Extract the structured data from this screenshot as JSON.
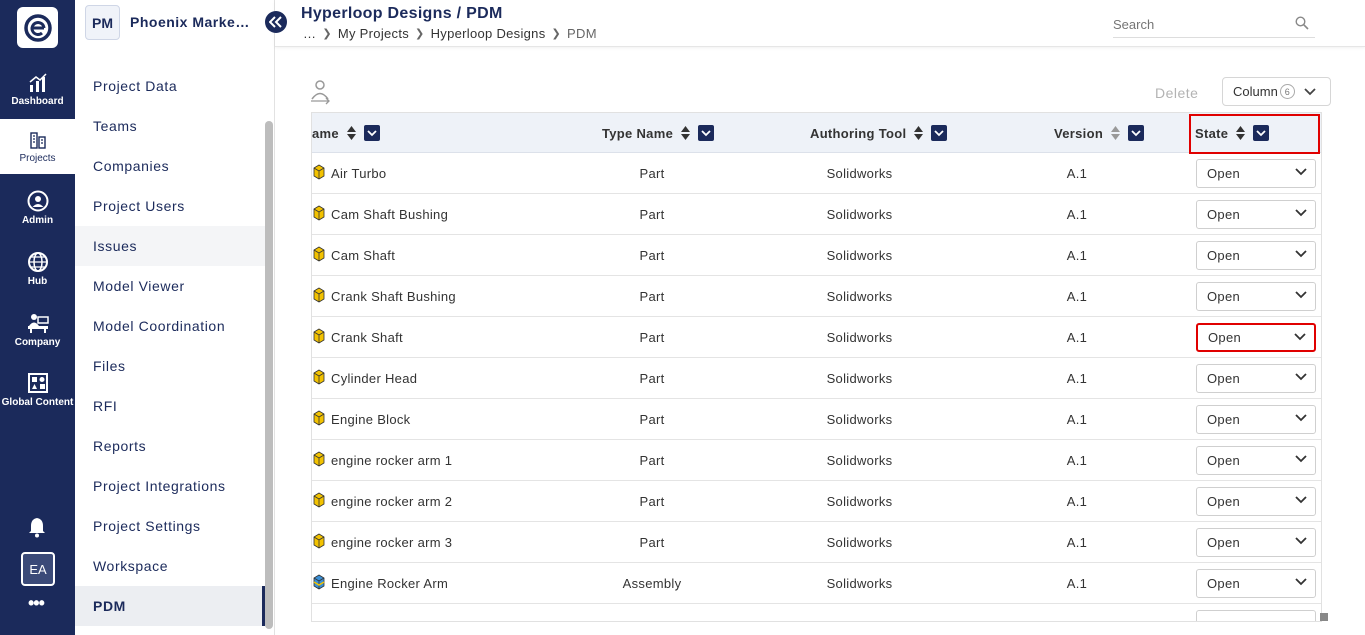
{
  "rail": {
    "items": [
      {
        "label": "Dashboard",
        "icon": "dashboard-icon"
      },
      {
        "label": "Projects",
        "icon": "projects-icon"
      },
      {
        "label": "Admin",
        "icon": "admin-icon"
      },
      {
        "label": "Hub",
        "icon": "hub-icon"
      },
      {
        "label": "Company",
        "icon": "company-icon"
      },
      {
        "label": "Global Content",
        "icon": "global-content-icon"
      }
    ],
    "active": "Projects",
    "avatar": "EA",
    "more": "•••"
  },
  "project": {
    "badge": "PM",
    "name": "Phoenix Marke…"
  },
  "nav": {
    "items": [
      "Project Data",
      "Teams",
      "Companies",
      "Project Users",
      "Issues",
      "Model Viewer",
      "Model Coordination",
      "Files",
      "RFI",
      "Reports",
      "Project Integrations",
      "Project Settings",
      "Workspace",
      "PDM"
    ],
    "active": "PDM",
    "hover": "Issues"
  },
  "header": {
    "title": "Hyperloop Designs / PDM",
    "breadcrumbs": [
      "…",
      "My Projects",
      "Hyperloop Designs",
      "PDM"
    ],
    "search_placeholder": "Search"
  },
  "toolbar": {
    "delete_label": "Delete",
    "column_label": "Column",
    "column_count": "6"
  },
  "table": {
    "columns": [
      "ame",
      "Type Name",
      "Authoring Tool",
      "Version",
      "State"
    ],
    "rows": [
      {
        "name": "Air Turbo",
        "type": "Part",
        "tool": "Solidworks",
        "version": "A.1",
        "state": "Open"
      },
      {
        "name": "Cam Shaft Bushing",
        "type": "Part",
        "tool": "Solidworks",
        "version": "A.1",
        "state": "Open"
      },
      {
        "name": "Cam Shaft",
        "type": "Part",
        "tool": "Solidworks",
        "version": "A.1",
        "state": "Open"
      },
      {
        "name": "Crank Shaft Bushing",
        "type": "Part",
        "tool": "Solidworks",
        "version": "A.1",
        "state": "Open"
      },
      {
        "name": "Crank Shaft",
        "type": "Part",
        "tool": "Solidworks",
        "version": "A.1",
        "state": "Open"
      },
      {
        "name": "Cylinder Head",
        "type": "Part",
        "tool": "Solidworks",
        "version": "A.1",
        "state": "Open"
      },
      {
        "name": "Engine Block",
        "type": "Part",
        "tool": "Solidworks",
        "version": "A.1",
        "state": "Open"
      },
      {
        "name": "engine rocker arm 1",
        "type": "Part",
        "tool": "Solidworks",
        "version": "A.1",
        "state": "Open"
      },
      {
        "name": "engine rocker arm 2",
        "type": "Part",
        "tool": "Solidworks",
        "version": "A.1",
        "state": "Open"
      },
      {
        "name": "engine rocker arm 3",
        "type": "Part",
        "tool": "Solidworks",
        "version": "A.1",
        "state": "Open"
      },
      {
        "name": "Engine Rocker Arm",
        "type": "Assembly",
        "tool": "Solidworks",
        "version": "A.1",
        "state": "Open"
      }
    ]
  },
  "colors": {
    "brand": "#1b2a5b",
    "highlight": "#e00000",
    "header_bg": "#eef2f8",
    "part_icon": "#f2c200",
    "assembly_icon": "#3a8fd6"
  }
}
